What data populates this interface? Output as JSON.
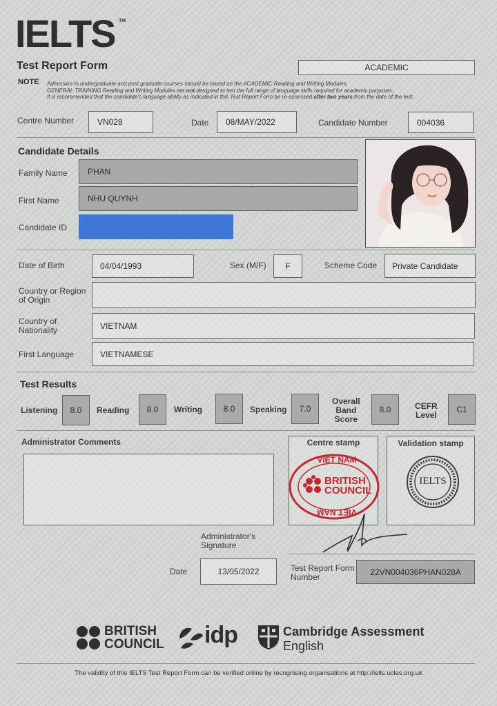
{
  "header": {
    "logo": "IELTS",
    "trademark": "TM",
    "form_title": "Test Report Form",
    "module": "ACADEMIC",
    "note_label": "NOTE",
    "note_line1": "Admission to undergraduate and post graduate courses should be based on the ACADEMIC Reading and Writing Modules.",
    "note_line2a": "GENERAL TRAINING Reading and Writing Modules are ",
    "note_line2b": "not",
    "note_line2c": " designed to test the full range of language skills required for academic purposes.",
    "note_line3a": "It is recommended that the candidate's language ability as indicated in this Test Report Form be re-assessed ",
    "note_line3b": "after two years",
    "note_line3c": " from the date of the test."
  },
  "centre": {
    "centre_number_label": "Centre Number",
    "centre_number": "VN028",
    "date_label": "Date",
    "date": "08/MAY/2022",
    "candidate_number_label": "Candidate Number",
    "candidate_number": "004036"
  },
  "candidate": {
    "section_title": "Candidate Details",
    "family_name_label": "Family Name",
    "family_name": "PHAN",
    "first_name_label": "First Name",
    "first_name": "NHU QUYNH",
    "candidate_id_label": "Candidate ID",
    "dob_label": "Date of Birth",
    "dob": "04/04/1993",
    "sex_label": "Sex (M/F)",
    "sex": "F",
    "scheme_code_label": "Scheme Code",
    "scheme_code": "Private Candidate",
    "country_origin_label1": "Country or Region",
    "country_origin_label2": "of Origin",
    "country_origin": "",
    "nationality_label1": "Country of",
    "nationality_label2": "Nationality",
    "nationality": "VIETNAM",
    "first_language_label": "First Language",
    "first_language": "VIETNAMESE"
  },
  "results": {
    "section_title": "Test Results",
    "listening_label": "Listening",
    "listening": "8.0",
    "reading_label": "Reading",
    "reading": "8.0",
    "writing_label": "Writing",
    "writing": "8.0",
    "speaking_label": "Speaking",
    "speaking": "7.0",
    "overall_label1": "Overall",
    "overall_label2": "Band",
    "overall_label3": "Score",
    "overall": "8.0",
    "cefr_label1": "CEFR",
    "cefr_label2": "Level",
    "cefr": "C1"
  },
  "admin": {
    "comments_label": "Administrator Comments",
    "centre_stamp_label": "Centre stamp",
    "validation_stamp_label": "Validation stamp",
    "stamp_top": "VIET NAM",
    "stamp_mid1": "BRITISH",
    "stamp_mid2": "COUNCIL",
    "stamp_bottom": "VIET NAM",
    "validation_text": "IELTS",
    "signature_label1": "Administrator's",
    "signature_label2": "Signature",
    "date_label": "Date",
    "date": "13/05/2022",
    "trf_label1": "Test Report Form",
    "trf_label2": "Number",
    "trf_number": "22VN004036PHAN028A"
  },
  "footer": {
    "bc_line1": "BRITISH",
    "bc_line2": "COUNCIL",
    "idp": "idp",
    "cambridge_line1": "Cambridge Assessment",
    "cambridge_line2": "English",
    "validity": "The validity of this IELTS Test Report Form can be verified online by recognising organisations at http://ielts.ucles.org.uk"
  },
  "colors": {
    "redaction": "#3f77d9",
    "stamp_red": "#c6262e"
  }
}
